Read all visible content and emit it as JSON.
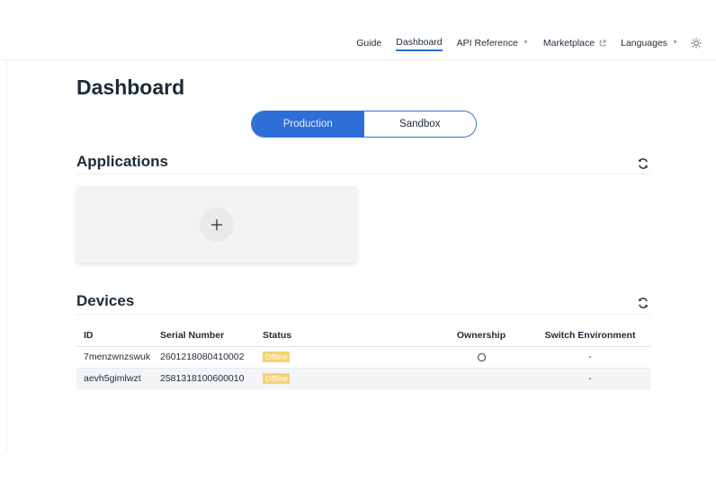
{
  "nav": {
    "items": [
      {
        "label": "Guide"
      },
      {
        "label": "Dashboard"
      },
      {
        "label": "API Reference"
      },
      {
        "label": "Marketplace"
      },
      {
        "label": "Languages"
      }
    ]
  },
  "page": {
    "title": "Dashboard"
  },
  "env_toggle": {
    "production": "Production",
    "sandbox": "Sandbox",
    "selected": "Production"
  },
  "applications": {
    "title": "Applications"
  },
  "devices": {
    "title": "Devices",
    "columns": [
      "ID",
      "Serial Number",
      "Status",
      "Ownership",
      "Switch Environment"
    ],
    "rows": [
      {
        "id": "7menzwnzswuk",
        "serial": "2601218080410002",
        "status": "Offline",
        "switch_env": "-",
        "ownership_control": true
      },
      {
        "id": "aevh5gimlwzt",
        "serial": "2581318100600010",
        "status": "Offline",
        "switch_env": "-",
        "ownership_control": false
      }
    ]
  },
  "colors": {
    "accent": "#2d6fd6",
    "status_offline": "#f7d372",
    "text": "#1c2b3a"
  },
  "icons": {
    "marketplace": "external-link-icon",
    "theme": "sun-icon",
    "refresh": "refresh-icon",
    "add": "plus-icon",
    "dropdown": "caret-down-icon"
  }
}
